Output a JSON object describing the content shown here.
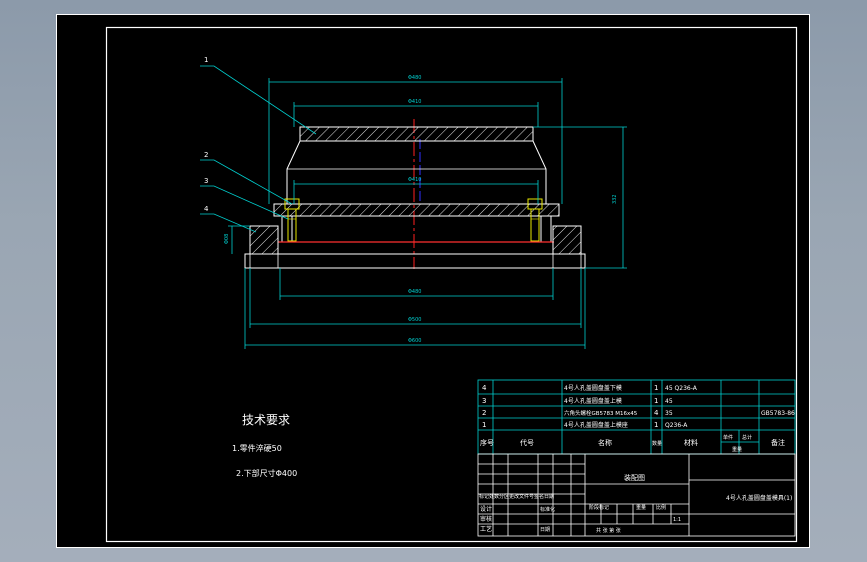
{
  "leaders": [
    "1",
    "2",
    "3",
    "4"
  ],
  "dimensions": {
    "top_outer": "Φ480",
    "top_inner": "Φ410",
    "middle": "Φ410",
    "base_inner": "Φ480",
    "base_mid": "Φ500",
    "base_outer": "Φ600",
    "height": "332",
    "left_step": "Φ08"
  },
  "notes": {
    "title": "技术要求",
    "items": [
      "1.零件淬硬50",
      "2.下部尺寸Φ400"
    ]
  },
  "bom": {
    "rows": [
      {
        "no": "4",
        "name": "4号人孔盖圆盘盖下模",
        "qty": "1",
        "material": "45 Q236-A",
        "remark": ""
      },
      {
        "no": "3",
        "name": "4号人孔盖圆盘盖上模",
        "qty": "1",
        "material": "45",
        "remark": ""
      },
      {
        "no": "2",
        "name": "六角头螺栓GB5783 M16x45",
        "qty": "4",
        "material": "35",
        "remark": "GB5783-86"
      },
      {
        "no": "1",
        "name": "4号人孔盖圆盘盖上模座",
        "qty": "1",
        "material": "Q236-A",
        "remark": ""
      }
    ],
    "headers": {
      "no": "序号",
      "code": "代号",
      "name": "名称",
      "qty": "数量",
      "material": "材料",
      "unit": "单件",
      "total": "总计",
      "weight": "重量",
      "remark": "备注"
    }
  },
  "title_block": {
    "material_mark": "装配图",
    "drawing_title": "4号人孔盖圆盘盖模具(1)",
    "row_labels": [
      "设计",
      "审核",
      "工艺",
      "批准"
    ],
    "change_label": "标记处数分区更改文件号签名日期",
    "stage_label": "阶段标记",
    "weight_label": "重量",
    "scale_label": "比例",
    "scale_value": "1:1",
    "sheets_label": "共 张 第 张",
    "std_label": "标准化",
    "date_label": "日期"
  }
}
